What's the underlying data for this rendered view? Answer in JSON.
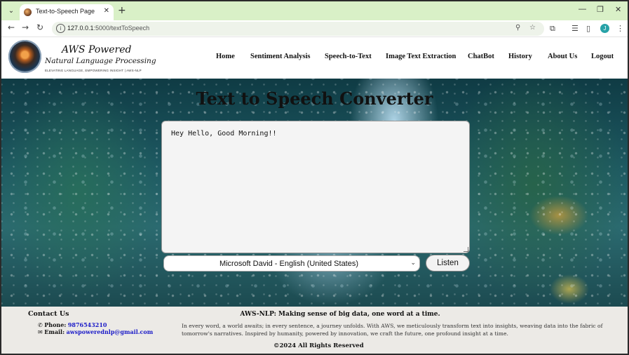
{
  "browser": {
    "tab_title": "Text-to-Speech Page",
    "url_host": "127.0.0.1",
    "url_path": ":5000/textToSpeech",
    "profile_initial": "J"
  },
  "brand": {
    "title": "AWS Powered",
    "subtitle": "Natural Language Processing",
    "tagline": "ELEVATING LANGUAGE, EMPOWERING INSIGHT | AWS-NLP"
  },
  "nav": {
    "items": [
      {
        "label": "Home"
      },
      {
        "label": "Sentiment Analysis"
      },
      {
        "label": "Speech-to-Text"
      },
      {
        "label": "Image Text Extraction"
      },
      {
        "label": "ChatBot"
      },
      {
        "label": "History"
      },
      {
        "label": "About Us"
      },
      {
        "label": "Logout"
      }
    ]
  },
  "main": {
    "title": "Text to Speech Converter",
    "input_text": "Hey Hello, Good Morning!!",
    "voice_selected": "Microsoft David - English (United States)",
    "listen_label": "Listen"
  },
  "footer": {
    "contact_heading": "Contact Us",
    "phone_label": "Phone:",
    "phone_value": "9876543210",
    "email_label": "Email:",
    "email_value": "awspowerednlp@gmail.com",
    "tagline": "AWS-NLP: Making sense of big data, one word at a time.",
    "paragraph": "In every word, a world awaits; in every sentence, a journey unfolds. With AWS, we meticulously transform text into insights, weaving data into the fabric of tomorrow's narratives. Inspired by humanity, powered by innovation, we craft the future, one profound insight at a time.",
    "copyright": "©2024 All Rights Reserved"
  },
  "icons": [
    "tab-menu-icon",
    "favicon-icon",
    "close-icon",
    "plus-icon",
    "minimize-icon",
    "restore-icon",
    "back-icon",
    "forward-icon",
    "reload-icon",
    "info-icon",
    "zoom-icon",
    "star-icon",
    "extensions-icon",
    "reading-list-icon",
    "side-panel-icon",
    "menu-icon",
    "phone-icon",
    "mail-icon",
    "chevron-down-icon"
  ]
}
